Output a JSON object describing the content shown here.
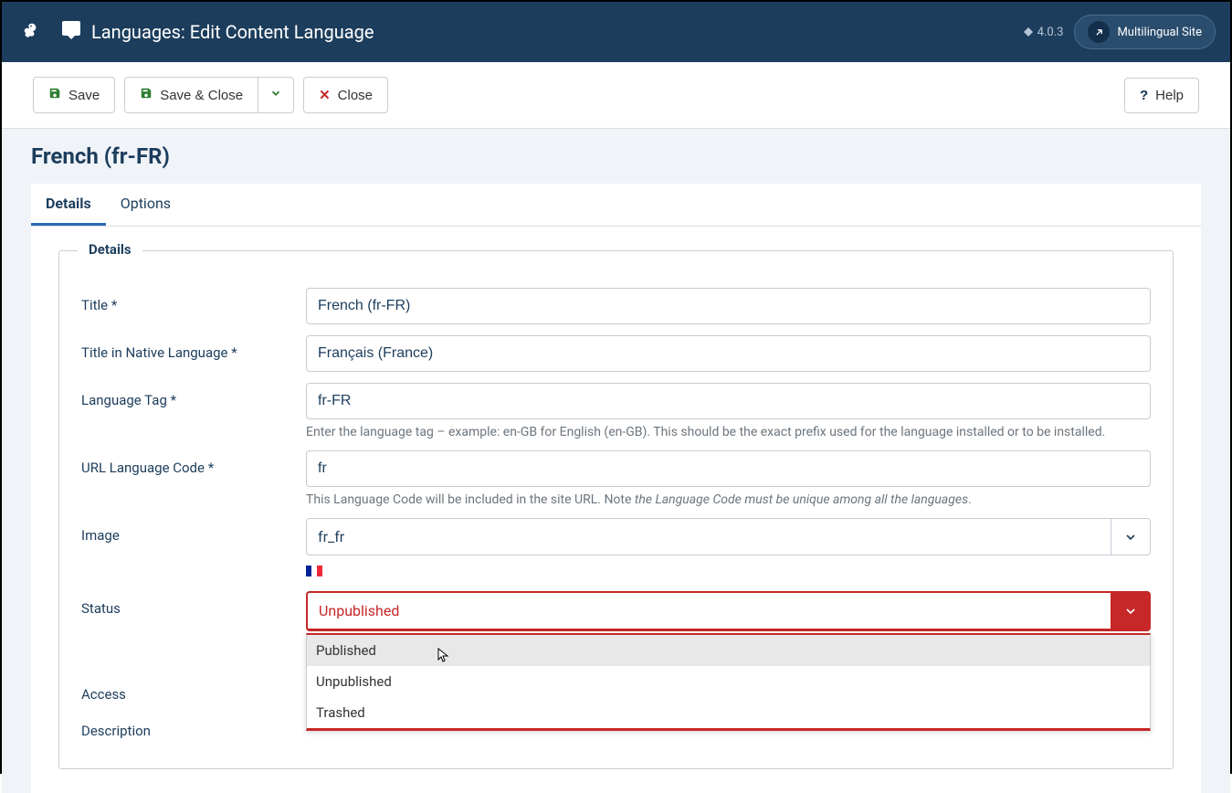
{
  "header": {
    "title": "Languages: Edit Content Language",
    "version": "4.0.3",
    "site_link": "Multilingual Site"
  },
  "toolbar": {
    "save": "Save",
    "save_close": "Save & Close",
    "close": "Close",
    "help": "Help"
  },
  "page": {
    "title": "French (fr-FR)"
  },
  "tabs": [
    {
      "label": "Details",
      "active": true
    },
    {
      "label": "Options",
      "active": false
    }
  ],
  "fieldset_legend": "Details",
  "fields": {
    "title": {
      "label": "Title *",
      "value": "French (fr-FR)"
    },
    "native": {
      "label": "Title in Native Language *",
      "value": "Français (France)"
    },
    "tag": {
      "label": "Language Tag *",
      "value": "fr-FR",
      "help": "Enter the language tag – example: en-GB for English (en-GB). This should be the exact prefix used for the language installed or to be installed."
    },
    "urlcode": {
      "label": "URL Language Code *",
      "value": "fr",
      "help_pre": "This Language Code will be included in the site URL. Note ",
      "help_em": "the Language Code must be unique among all the languages",
      "help_post": "."
    },
    "image": {
      "label": "Image",
      "value": "fr_fr"
    },
    "status": {
      "label": "Status",
      "value": "Unpublished",
      "options": [
        "Published",
        "Unpublished",
        "Trashed"
      ]
    },
    "access": {
      "label": "Access"
    },
    "description": {
      "label": "Description"
    }
  }
}
